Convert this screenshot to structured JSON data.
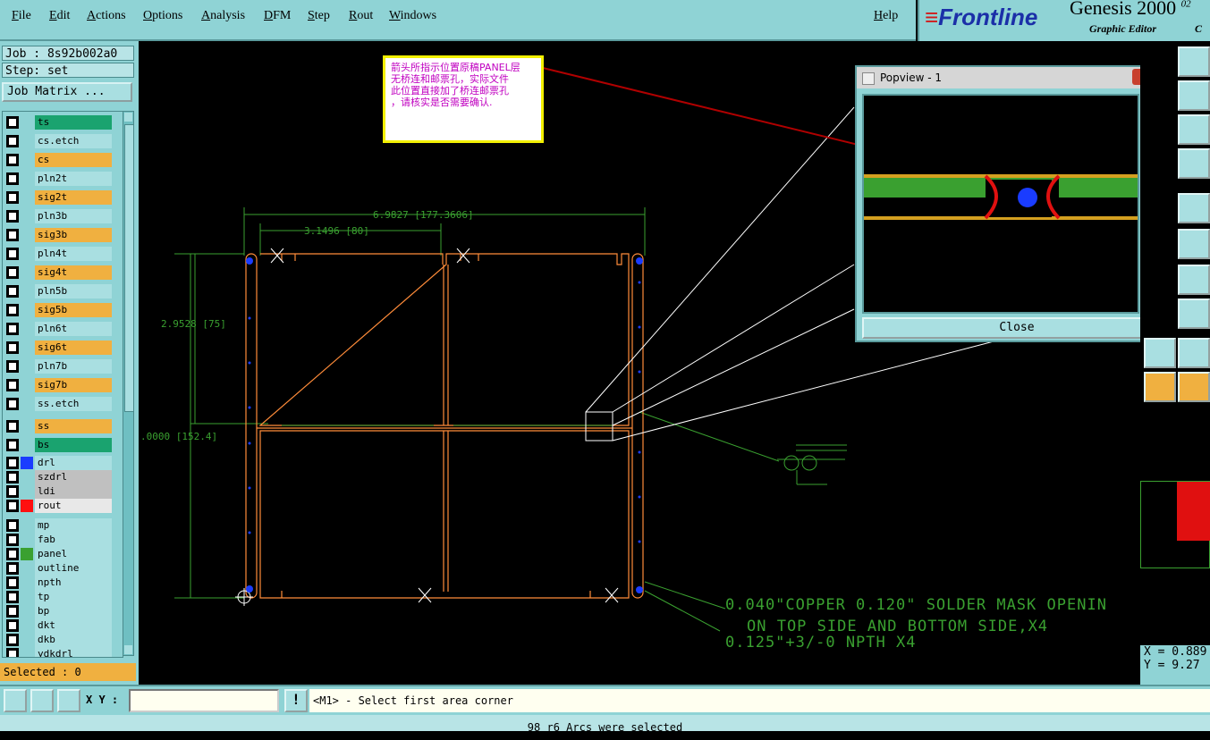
{
  "menu": {
    "file": "File",
    "edit": "Edit",
    "actions": "Actions",
    "options": "Options",
    "analysis": "Analysis",
    "dfm": "DFM",
    "step": "Step",
    "rout": "Rout",
    "windows": "Windows",
    "help": "Help"
  },
  "brand": {
    "logo_prefix": "Front",
    "logo_suffix": "line",
    "title": "Genesis 2000",
    "subtitle": "Graphic Editor",
    "version": "02",
    "extra": "C"
  },
  "job": {
    "job": "Job : 8s92b002a0",
    "step": "Step: set",
    "matrix_button": "Job Matrix ..."
  },
  "layers": [
    {
      "name": "ts",
      "color": "#1aa36f",
      "swatch": ""
    },
    {
      "name": "cs.etch",
      "color": "#a9dfe1",
      "swatch": ""
    },
    {
      "name": "cs",
      "color": "#f0b040",
      "swatch": ""
    },
    {
      "name": "pln2t",
      "color": "#a9dfe1",
      "swatch": ""
    },
    {
      "name": "sig2t",
      "color": "#f0b040",
      "swatch": ""
    },
    {
      "name": "pln3b",
      "color": "#a9dfe1",
      "swatch": ""
    },
    {
      "name": "sig3b",
      "color": "#f0b040",
      "swatch": ""
    },
    {
      "name": "pln4t",
      "color": "#a9dfe1",
      "swatch": ""
    },
    {
      "name": "sig4t",
      "color": "#f0b040",
      "swatch": ""
    },
    {
      "name": "pln5b",
      "color": "#a9dfe1",
      "swatch": ""
    },
    {
      "name": "sig5b",
      "color": "#f0b040",
      "swatch": ""
    },
    {
      "name": "pln6t",
      "color": "#a9dfe1",
      "swatch": ""
    },
    {
      "name": "sig6t",
      "color": "#f0b040",
      "swatch": ""
    },
    {
      "name": "pln7b",
      "color": "#a9dfe1",
      "swatch": ""
    },
    {
      "name": "sig7b",
      "color": "#f0b040",
      "swatch": ""
    },
    {
      "name": "ss.etch",
      "color": "#a9dfe1",
      "swatch": ""
    },
    {
      "name": "ss",
      "color": "#f0b040",
      "swatch": ""
    },
    {
      "name": "bs",
      "color": "#1aa36f",
      "swatch": ""
    },
    {
      "name": "drl",
      "color": "#a9dfe1",
      "swatch": "#1a3cff"
    },
    {
      "name": "szdrl",
      "color": "#c0c0c0",
      "swatch": ""
    },
    {
      "name": "ldi",
      "color": "#c0c0c0",
      "swatch": ""
    },
    {
      "name": "rout",
      "color": "#e8e8e8",
      "swatch": "#ff1010"
    },
    {
      "name": "mp",
      "color": "#a9dfe1",
      "swatch": ""
    },
    {
      "name": "fab",
      "color": "#a9dfe1",
      "swatch": ""
    },
    {
      "name": "panel",
      "color": "#a9dfe1",
      "swatch": "#3aa030"
    },
    {
      "name": "outline",
      "color": "#a9dfe1",
      "swatch": ""
    },
    {
      "name": "npth",
      "color": "#a9dfe1",
      "swatch": ""
    },
    {
      "name": "tp",
      "color": "#a9dfe1",
      "swatch": ""
    },
    {
      "name": "bp",
      "color": "#a9dfe1",
      "swatch": ""
    },
    {
      "name": "dkt",
      "color": "#a9dfe1",
      "swatch": ""
    },
    {
      "name": "dkb",
      "color": "#a9dfe1",
      "swatch": ""
    },
    {
      "name": "ydkdrl",
      "color": "#a9dfe1",
      "swatch": ""
    }
  ],
  "selected": "Selected : 0",
  "callout": {
    "line1": "箭头所指示位置原稿PANEL层",
    "line2": "无桥连和邮票孔，实际文件",
    "line3": "此位置直接加了桥连邮票孔",
    "line4": "，请核实是否需要确认."
  },
  "dimensions": {
    "width": "6.9827 [177.3606]",
    "half_width": "3.1496 [80]",
    "half_height": "2.9528 [75]",
    "height": ".0000 [152.4]"
  },
  "note": {
    "line1": "0.040\"COPPER 0.120\" SOLDER MASK OPENIN",
    "line2": "ON TOP SIDE AND BOTTOM SIDE,X4",
    "line3": "0.125\"+3/-0 NPTH X4"
  },
  "popview": {
    "title": "Popview - 1",
    "close": "Close",
    "close_x": "✕"
  },
  "coords": {
    "x": "X = 0.889",
    "y": "Y = 9.27"
  },
  "xy": {
    "label": "X Y :",
    "value": ""
  },
  "prompt": "<M1> - Select first area corner",
  "status": "98 r6 Arcs were selected",
  "colors": {
    "menu_bg": "#8fd3d5",
    "outline": "#ff8c3a",
    "dimension": "#3aa030",
    "drill": "#1a3cff",
    "callout_text": "#c000c0",
    "arrow": "#b00000"
  }
}
